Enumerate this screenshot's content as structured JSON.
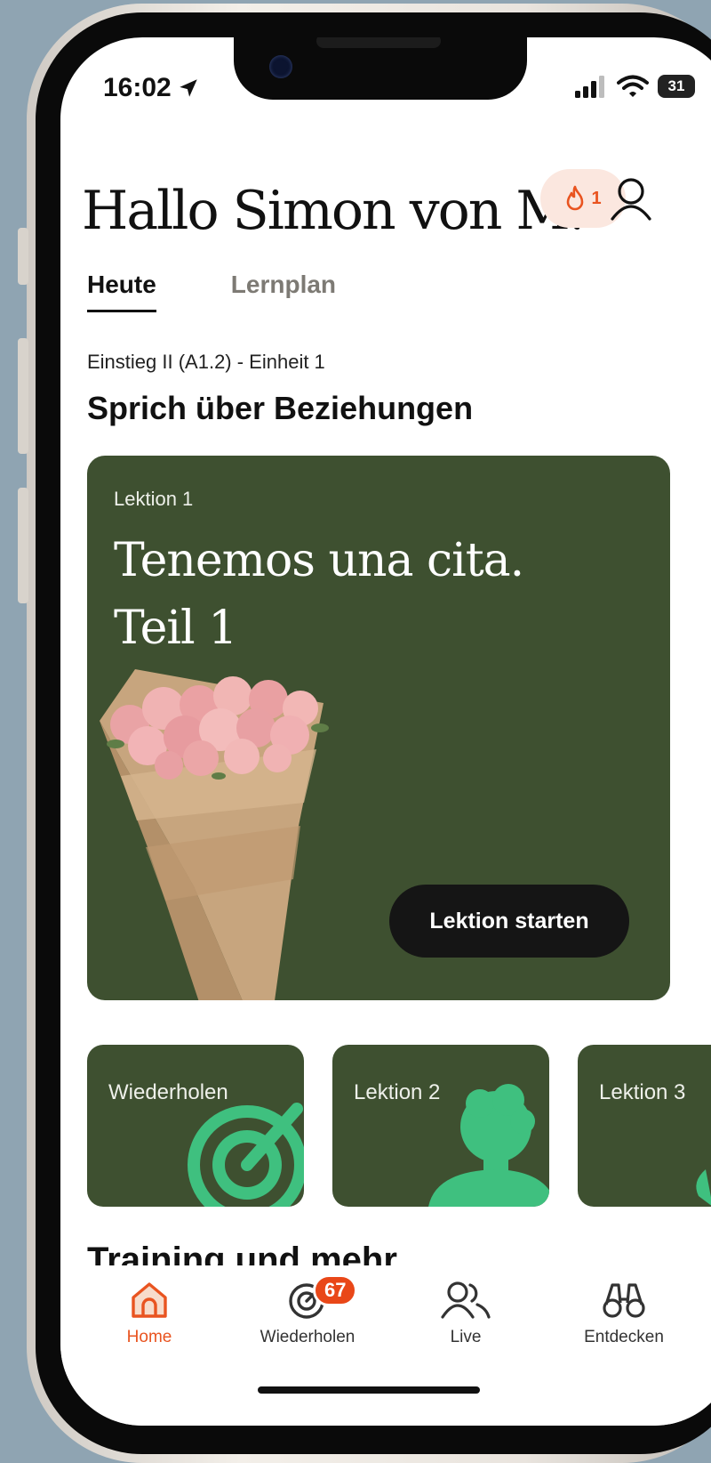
{
  "status_bar": {
    "time": "16:02",
    "battery": "31"
  },
  "header": {
    "greeting": "Hallo Simon von M...",
    "streak_count": "1"
  },
  "tabs": [
    {
      "label": "Heute",
      "active": true
    },
    {
      "label": "Lernplan",
      "active": false
    }
  ],
  "unit": {
    "label": "Einstieg II (A1.2) - Einheit 1",
    "title": "Sprich über Beziehungen"
  },
  "hero": {
    "lesson_label": "Lektion 1",
    "title_line1": "Tenemos una cita.",
    "title_line2": "Teil 1",
    "start_button": "Lektion starten"
  },
  "cards": [
    {
      "label": "Wiederholen"
    },
    {
      "label": "Lektion 2"
    },
    {
      "label": "Lektion 3"
    }
  ],
  "section_peek": "Training und mehr",
  "tabbar": {
    "home": "Home",
    "review": "Wiederholen",
    "review_badge": "67",
    "live": "Live",
    "discover": "Entdecken"
  },
  "colors": {
    "accent": "#e95420",
    "card_green": "#3e5030",
    "art_green": "#3fc07f"
  }
}
